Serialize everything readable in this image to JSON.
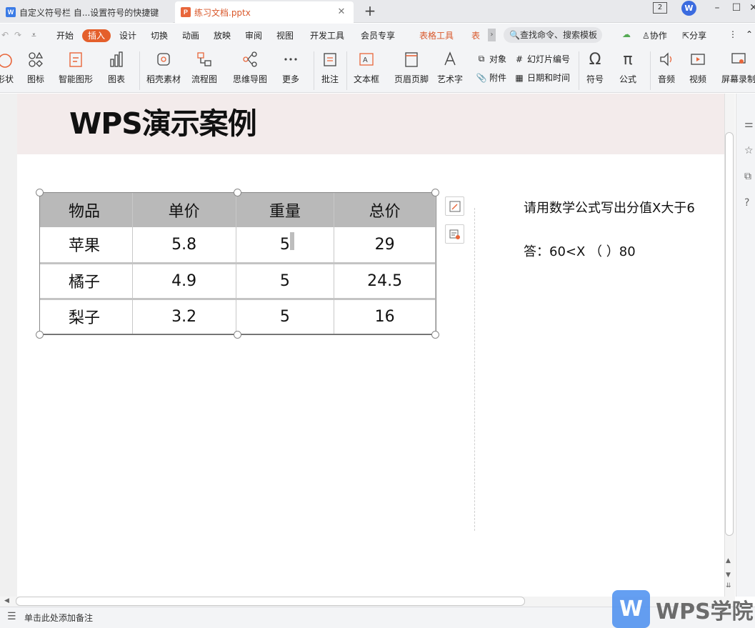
{
  "tabs": [
    {
      "label": "自定义符号栏 自...设置符号的快捷键",
      "icon": "word-doc-icon"
    },
    {
      "label": "练习文档.pptx",
      "icon": "ppt-doc-icon"
    }
  ],
  "window": {
    "count_badge": "2",
    "wps_badge": "W"
  },
  "menu": {
    "items": [
      "开始",
      "插入",
      "设计",
      "切换",
      "动画",
      "放映",
      "审阅",
      "视图",
      "开发工具",
      "会员专享"
    ],
    "active": "插入",
    "context_items": [
      "表格工具",
      "表格"
    ],
    "search_placeholder": "查找命令、搜索模板",
    "collaborate": "协作",
    "share": "分享"
  },
  "ribbon": {
    "shape": "形状",
    "icon": "图标",
    "smartart": "智能图形",
    "chart": "图表",
    "material": "稻壳素材",
    "flowchart": "流程图",
    "mindmap": "思维导图",
    "more": "更多",
    "comment": "批注",
    "textbox": "文本框",
    "header_footer": "页眉页脚",
    "wordart": "艺术字",
    "object": "对象",
    "attachment": "附件",
    "slide_number": "幻灯片编号",
    "datetime": "日期和时间",
    "symbol": "符号",
    "formula": "公式",
    "audio": "音频",
    "video": "视频",
    "screen_record": "屏幕录制"
  },
  "slide": {
    "title": "WPS演示案例",
    "table": {
      "headers": [
        "物品",
        "单价",
        "重量",
        "总价"
      ],
      "rows": [
        [
          "苹果",
          "5.8",
          "5",
          "29"
        ],
        [
          "橘子",
          "4.9",
          "5",
          "24.5"
        ],
        [
          "梨子",
          "3.2",
          "5",
          "16"
        ]
      ]
    },
    "question": "请用数学公式写出分值X大于6",
    "answer": "答：60<X （   ）80"
  },
  "notes": {
    "placeholder": "单击此处添加备注"
  },
  "watermark": {
    "logo": "W",
    "text": "WPS学院"
  }
}
